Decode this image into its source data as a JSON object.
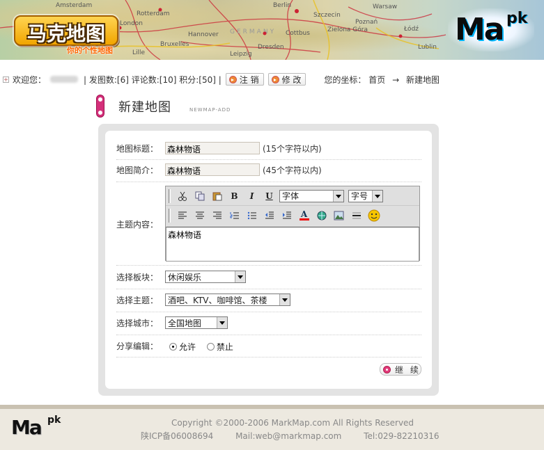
{
  "header": {
    "logo_cn": "马克地图",
    "logo_tagline": "你的个性地图",
    "logo_mark_main": "Ma",
    "logo_mark_sup": "pk",
    "map_labels": [
      "Amsterdam",
      "Berlin",
      "Warsaw",
      "London",
      "Hannover",
      "Rotterdam",
      "Zielona Góra",
      "Poznań",
      "Łódź",
      "Lublin",
      "Lille",
      "Bruxelles",
      "Dresden",
      "Leipzig",
      "Cottbus",
      "Szczecin",
      "GERMANY"
    ]
  },
  "userbar": {
    "welcome_label": "欢迎您：",
    "stats": "| 发图数:[6] 评论数:[10] 积分:[50] |",
    "logout_label": "注 销",
    "edit_label": "修 改",
    "coords_label": "您的坐标：",
    "crumb_home": "首页",
    "crumb_arrow": "→",
    "crumb_current": "新建地图"
  },
  "title": {
    "text": "新建地图",
    "subtitle": "NEWMAP-ADD"
  },
  "form": {
    "map_title": {
      "label": "地图标题：",
      "value": "森林物语",
      "hint": "(15个字符以内)"
    },
    "map_intro": {
      "label": "地图简介：",
      "value": "森林物语",
      "hint": "(45个字符以内)"
    },
    "content": {
      "label": "主题内容：",
      "value": "森林物语",
      "font_select": "字体",
      "size_select": "字号",
      "toolbar_row1": [
        "cut-icon",
        "copy-icon",
        "paste-icon",
        "bold-icon",
        "italic-icon",
        "underline-icon"
      ],
      "toolbar_row2": [
        "align-left-icon",
        "align-center-icon",
        "align-right-icon",
        "ordered-list-icon",
        "unordered-list-icon",
        "outdent-icon",
        "indent-icon",
        "font-color-icon",
        "link-icon",
        "image-icon",
        "horizontal-rule-icon",
        "emoticon-icon"
      ],
      "bold_glyph": "B",
      "italic_glyph": "I",
      "underline_glyph": "U",
      "color_glyph": "A"
    },
    "board": {
      "label": "选择板块：",
      "value": "休闲娱乐"
    },
    "topic": {
      "label": "选择主题：",
      "value": "酒吧、KTV、咖啡馆、茶楼"
    },
    "city": {
      "label": "选择城市：",
      "value": "全国地图"
    },
    "share": {
      "label": "分享编辑：",
      "allow": "允许",
      "deny": "禁止",
      "selected": "允许"
    },
    "continue_label": "继 续"
  },
  "footer": {
    "copyright": "Copyright ©2000-2006 MarkMap.com All Rights Reserved",
    "icp": "陕ICP备06008694",
    "mail": "Mail:web@markmap.com",
    "tel": "Tel:029-82210316",
    "logo_main": "Ma",
    "logo_sup": "pk"
  },
  "colors": {
    "accent_pink": "#d4307a",
    "logo_orange": "#f1a500",
    "panel_gray": "#e3e3e3",
    "footer_bg": "#ede9e0"
  }
}
